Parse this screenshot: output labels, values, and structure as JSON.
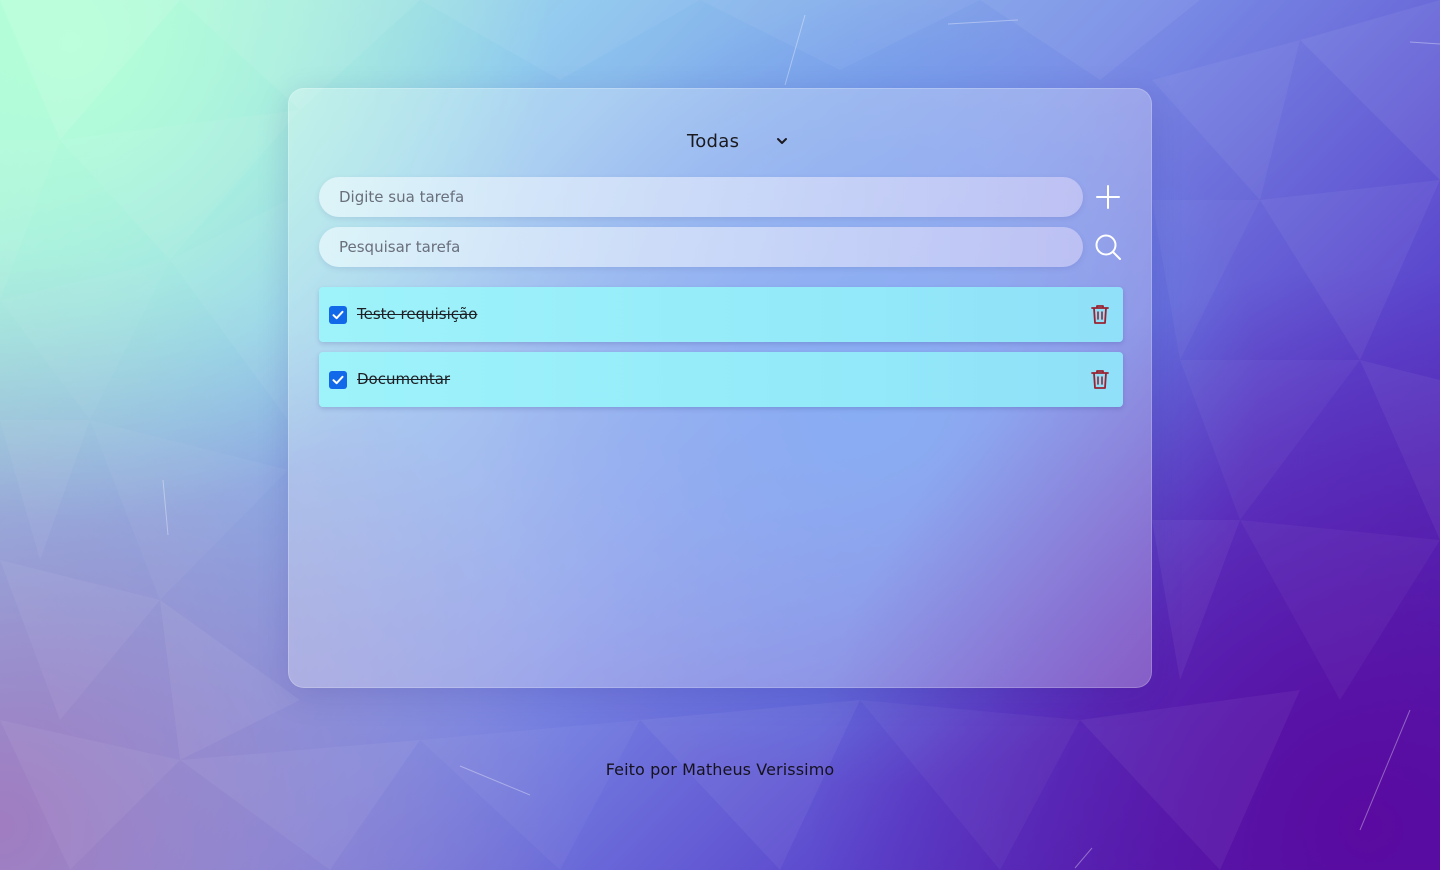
{
  "filter": {
    "selected": "Todas"
  },
  "add_task": {
    "placeholder": "Digite sua tarefa",
    "icon": "plus-icon"
  },
  "search_task": {
    "placeholder": "Pesquisar tarefa",
    "icon": "search-icon"
  },
  "tasks": [
    {
      "text": "Teste requisição",
      "completed": true
    },
    {
      "text": "Documentar",
      "completed": true
    }
  ],
  "footer": {
    "text": "Feito por Matheus Verissimo"
  },
  "colors": {
    "checkbox": "#1168e8",
    "trash": "#9b2232",
    "task_bg": "#9ef3fa"
  }
}
